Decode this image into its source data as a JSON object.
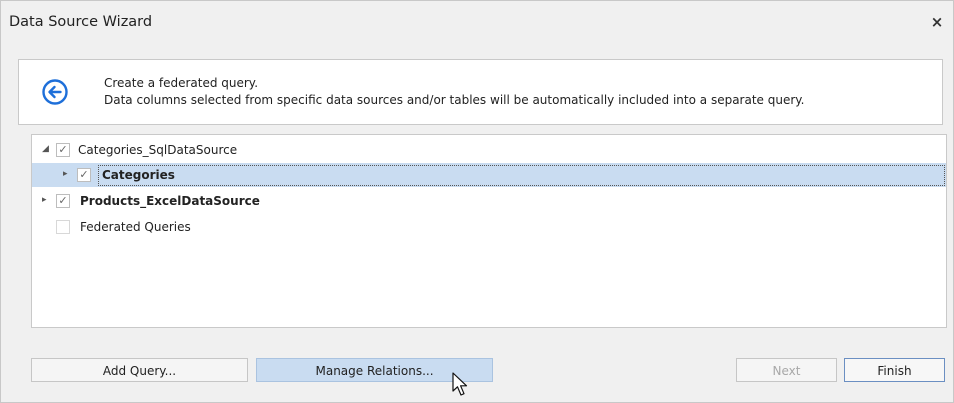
{
  "window": {
    "title": "Data Source Wizard",
    "close_label": "×"
  },
  "header": {
    "line1": "Create a federated query.",
    "line2": "Data columns selected from specific data sources and/or tables will be automatically included into a separate query."
  },
  "tree": {
    "items": [
      {
        "label": "Categories_SqlDataSource",
        "checked": true,
        "expander": "◢"
      },
      {
        "label": "Categories",
        "checked": true,
        "expander": "▸"
      },
      {
        "label": "Products_ExcelDataSource",
        "checked": true,
        "expander": "▸"
      },
      {
        "label": "Federated Queries",
        "checked": false,
        "expander": ""
      }
    ]
  },
  "buttons": {
    "add_query": "Add Query...",
    "manage_relations": "Manage Relations...",
    "next": "Next",
    "finish": "Finish"
  },
  "colors": {
    "accent": "#1e6fd9",
    "selection": "#c9dcf1"
  }
}
